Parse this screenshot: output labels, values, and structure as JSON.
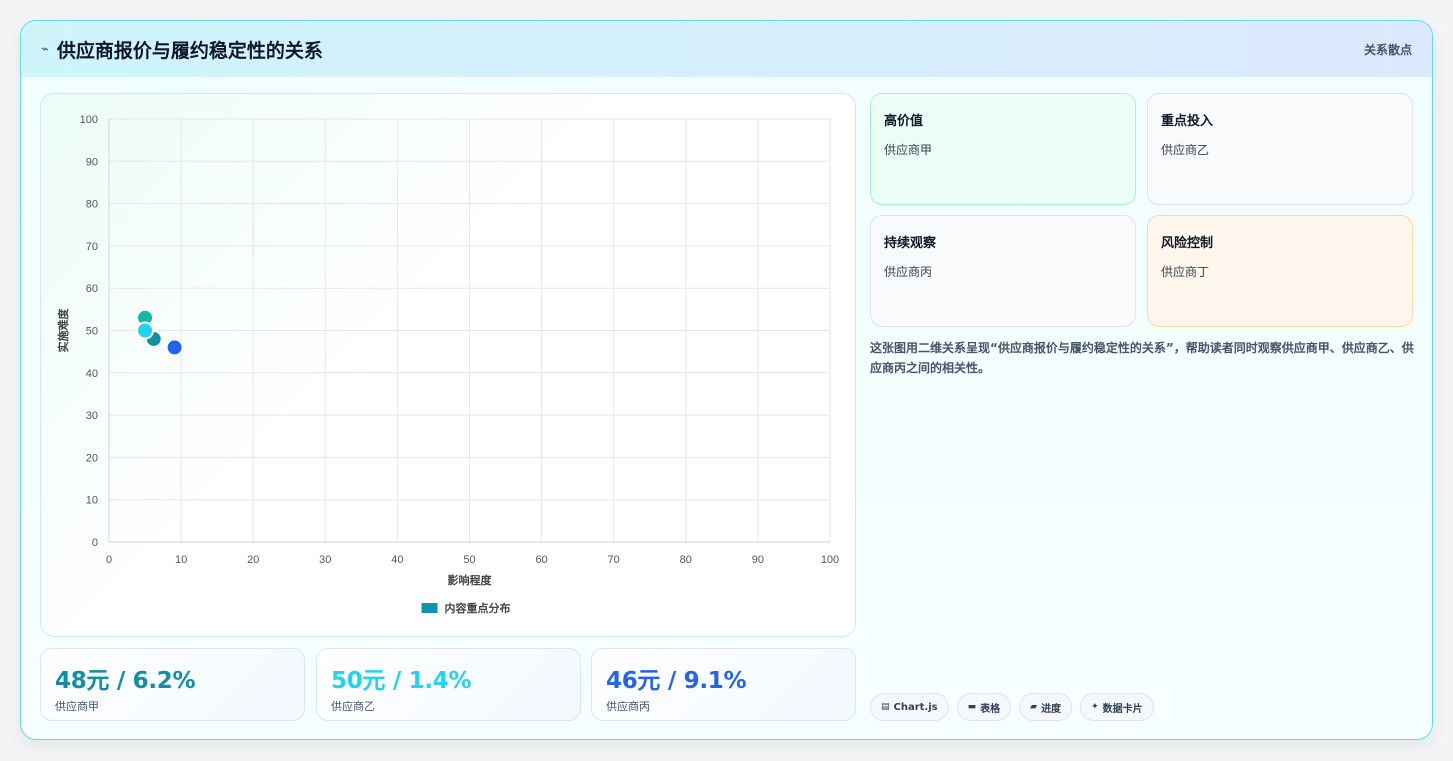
{
  "header": {
    "title": "供应商报价与履约稳定性的关系",
    "badge": "关系散点"
  },
  "chart_data": {
    "type": "scatter",
    "xlabel": "影响程度",
    "ylabel": "实施难度",
    "xlim": [
      0,
      100
    ],
    "ylim": [
      0,
      100
    ],
    "xticks": [
      "0",
      "10",
      "20",
      "30",
      "40",
      "50",
      "60",
      "70",
      "80",
      "90",
      "100"
    ],
    "yticks": [
      "0",
      "10",
      "20",
      "30",
      "40",
      "50",
      "60",
      "70",
      "80",
      "90",
      "100"
    ],
    "grid": true,
    "legend": {
      "label": "内容重点分布",
      "color": "#0e93b0",
      "position": "bottom"
    },
    "points": [
      {
        "x": 6.2,
        "y": 48,
        "color": "#0e8fa3"
      },
      {
        "x": 5,
        "y": 53,
        "color": "#14b8a6"
      },
      {
        "x": 5,
        "y": 50,
        "color": "#22d3ee"
      },
      {
        "x": 9.1,
        "y": 46,
        "color": "#2563eb"
      }
    ]
  },
  "stats": [
    {
      "value": "48元 / 6.2%",
      "label": "供应商甲",
      "color": "#0e8fa3"
    },
    {
      "value": "50元 / 1.4%",
      "label": "供应商乙",
      "color": "#22d3ee"
    },
    {
      "value": "46元 / 9.1%",
      "label": "供应商丙",
      "color": "#2563eb"
    }
  ],
  "quadrants": [
    {
      "title": "高价值",
      "item": "供应商甲"
    },
    {
      "title": "重点投入",
      "item": "供应商乙"
    },
    {
      "title": "持续观察",
      "item": "供应商丙"
    },
    {
      "title": "风险控制",
      "item": "供应商丁"
    }
  ],
  "description": "这张图用二维关系呈现“供应商报价与履约稳定性的关系”，帮助读者同时观察供应商甲、供应商乙、供应商丙之间的相关性。",
  "tags": [
    {
      "label": "Chart.js",
      "icon": "chart-icon"
    },
    {
      "label": "表格",
      "icon": "table-icon"
    },
    {
      "label": "进度",
      "icon": "progress-icon"
    },
    {
      "label": "数据卡片",
      "icon": "sparkle-icon"
    }
  ]
}
